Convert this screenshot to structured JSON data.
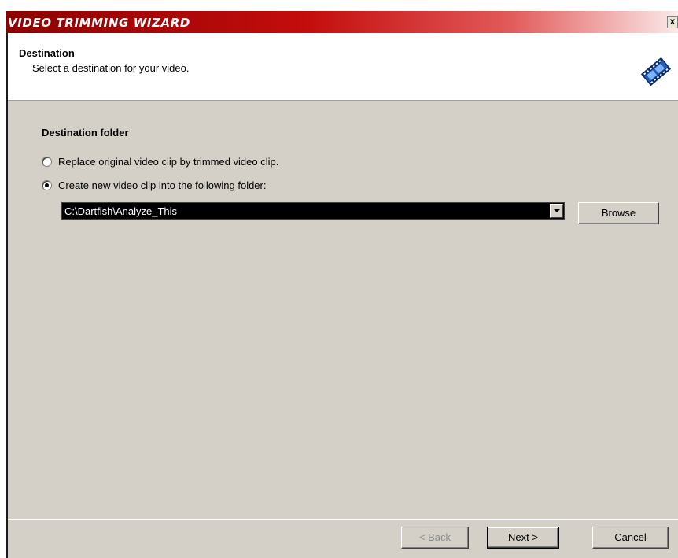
{
  "window": {
    "title": "VIDEO TRIMMING WIZARD",
    "close_label": "x"
  },
  "header": {
    "title": "Destination",
    "subtitle": "Select a destination for your video.",
    "icon": "film-strip-icon"
  },
  "section": {
    "title": "Destination folder"
  },
  "options": {
    "replace_label": "Replace original video clip by trimmed video clip.",
    "replace_selected": false,
    "create_label": "Create new video clip into the following folder:",
    "create_selected": true
  },
  "folder": {
    "value": "C:\\Dartfish\\Analyze_This"
  },
  "buttons": {
    "browse": "Browse",
    "back": "< Back",
    "next": "Next >",
    "cancel": "Cancel"
  },
  "colors": {
    "title_gradient_start": "#8e0000",
    "title_gradient_end": "#fbe9e9",
    "dialog_bg": "#d4d0c8",
    "combo_bg": "#000000"
  }
}
